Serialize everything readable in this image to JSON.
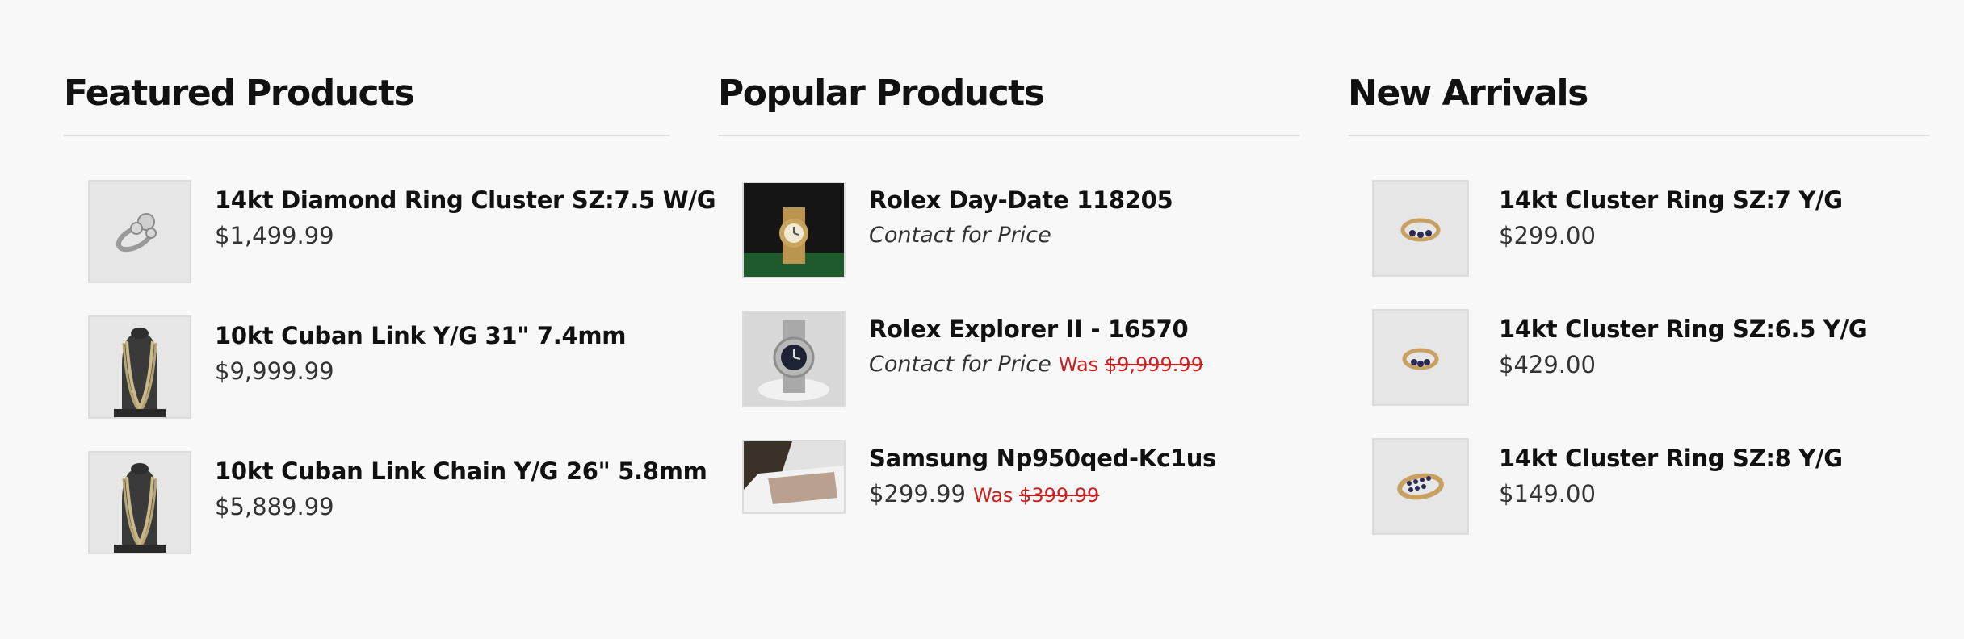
{
  "sections": [
    {
      "title": "Featured Products",
      "items": [
        {
          "name": "14kt Diamond Ring Cluster SZ:7.5 W/G",
          "price": "$1,499.99",
          "image": "ring-icon"
        },
        {
          "name": "10kt Cuban Link Y/G 31\" 7.4mm",
          "price": "$9,999.99",
          "image": "necklace-icon"
        },
        {
          "name": "10kt Cuban Link Chain Y/G 26\" 5.8mm",
          "price": "$5,889.99",
          "image": "necklace-icon"
        }
      ]
    },
    {
      "title": "Popular Products",
      "items": [
        {
          "name": "Rolex Day-Date 118205",
          "price_note": "Contact for Price",
          "image": "gold-watch-icon"
        },
        {
          "name": "Rolex Explorer II - 16570",
          "price_note": "Contact for Price",
          "was_label": "Was",
          "was_price": "$9,999.99",
          "image": "steel-watch-icon"
        },
        {
          "name": "Samsung Np950qed-Kc1us",
          "price": "$299.99",
          "was_label": "Was",
          "was_price": "$399.99",
          "image": "laptop-icon"
        }
      ]
    },
    {
      "title": "New Arrivals",
      "items": [
        {
          "name": "14kt Cluster Ring SZ:7 Y/G",
          "price": "$299.00",
          "image": "gold-ring-icon"
        },
        {
          "name": "14kt Cluster Ring SZ:6.5 Y/G",
          "price": "$429.00",
          "image": "gold-ring-icon"
        },
        {
          "name": "14kt Cluster Ring SZ:8 Y/G",
          "price": "$149.00",
          "image": "gold-band-icon"
        }
      ]
    }
  ]
}
